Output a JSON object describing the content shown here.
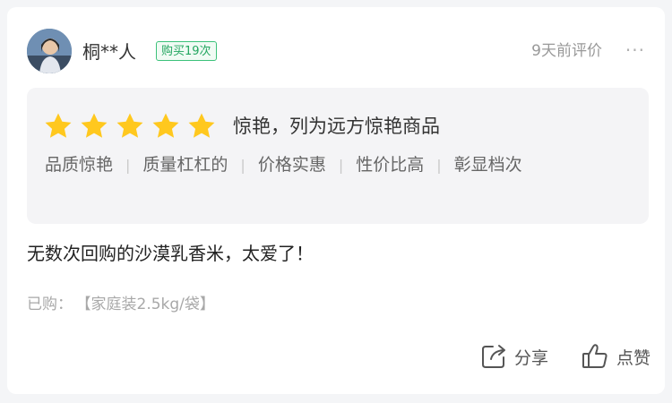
{
  "user": {
    "name": "桐**人",
    "avatar_icon": "user-avatar-photo",
    "purchase_badge": "购买19次"
  },
  "header": {
    "time_text": "9天前评价",
    "more_icon": "more-dots-icon",
    "more_text": "···"
  },
  "rating": {
    "stars": 5,
    "max_stars": 5,
    "star_color": "#ffc81e",
    "text": "惊艳，列为远方惊艳商品",
    "tags": [
      "品质惊艳",
      "质量杠杠的",
      "价格实惠",
      "性价比高",
      "彰显档次"
    ]
  },
  "review": {
    "text": "无数次回购的沙漠乳香米，太爱了！"
  },
  "purchased": {
    "label": "已购：",
    "spec": "【家庭装2.5kg/袋】"
  },
  "actions": {
    "share_label": "分享",
    "share_icon": "share-icon",
    "like_label": "点赞",
    "like_icon": "thumbs-up-icon"
  },
  "colors": {
    "badge_green": "#23a660",
    "background": "#f4f5f7",
    "card": "#ffffff"
  }
}
